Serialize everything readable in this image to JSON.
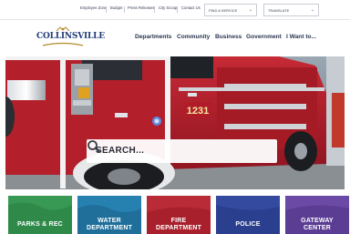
{
  "utility_bar": {
    "links": [
      "Employee Zone",
      "Budget",
      "Press Releases",
      "City Scoop",
      "Contact Us"
    ],
    "find_service": "FIND A SERVICE",
    "translate": "TRANSLATE"
  },
  "header": {
    "logo_text": "COLLINSVILLE",
    "nav": [
      "Departments",
      "Community",
      "Business",
      "Government",
      "I Want to..."
    ]
  },
  "hero": {
    "truck_number": "1231",
    "search_label": "SEARCH..."
  },
  "tiles": [
    {
      "label_1": "PARKS & REC",
      "label_2": "",
      "color": "#2f8a4a"
    },
    {
      "label_1": "WATER",
      "label_2": "DEPARTMENT",
      "color": "#1f6f9a"
    },
    {
      "label_1": "FIRE",
      "label_2": "DEPARTMENT",
      "color": "#a8202c"
    },
    {
      "label_1": "POLICE",
      "label_2": "",
      "color": "#2b3f8f"
    },
    {
      "label_1": "GATEWAY",
      "label_2": "CENTER",
      "color": "#5b3d94"
    }
  ]
}
